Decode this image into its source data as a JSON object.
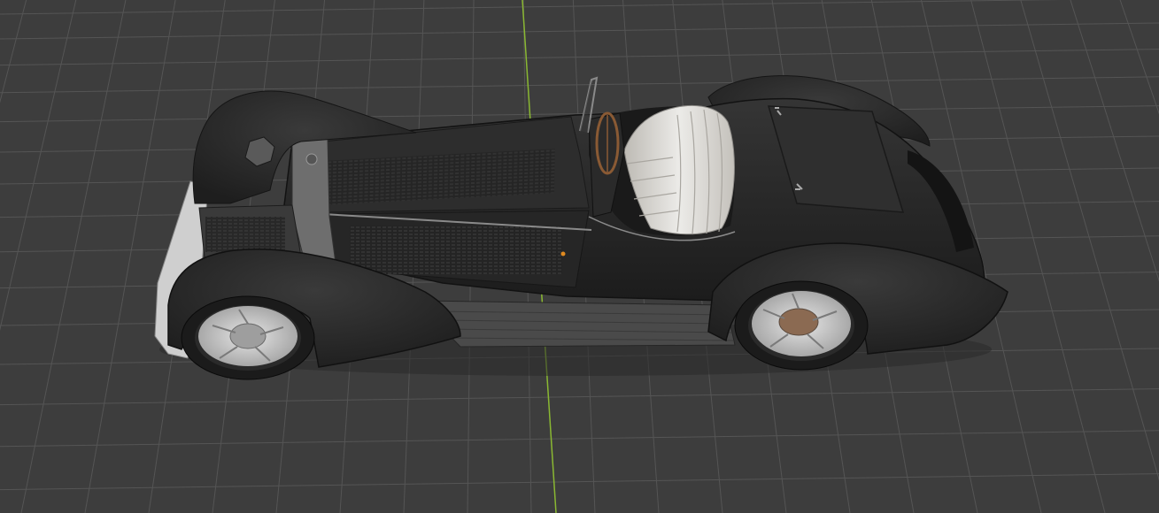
{
  "viewport": {
    "background": "#3d3d3d",
    "grid_color": "#555555",
    "y_axis_color": "#8ab832"
  },
  "model": {
    "body_color": "#2b2b2b",
    "upholstery_color": "#dcdad6",
    "wheel_color": "#c8c8c8",
    "steering_wheel_color": "#8a5a34",
    "indicator_color": "#e08a20"
  }
}
